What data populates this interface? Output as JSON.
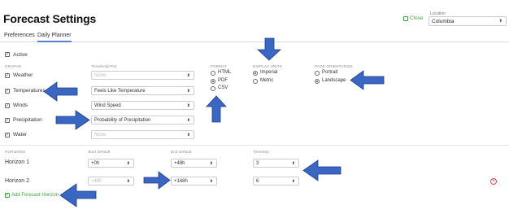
{
  "header": {
    "title": "Forecast Settings",
    "close_label": "Close",
    "location_label": "Location",
    "location_value": "Columbia"
  },
  "tabs": [
    {
      "label": "Preferences",
      "active": false
    },
    {
      "label": "Daily Planner",
      "active": true
    }
  ],
  "active": {
    "label": "Active",
    "checked": true
  },
  "graphs": {
    "header": "GRAPHS",
    "threshold_header": "Threshold Plot",
    "rows": [
      {
        "label": "Weather",
        "checked": true,
        "threshold": "None",
        "threshold_muted": true
      },
      {
        "label": "Temperatures",
        "checked": true,
        "threshold": "Feels Like Temperature",
        "threshold_muted": false
      },
      {
        "label": "Winds",
        "checked": true,
        "threshold": "Wind Speed",
        "threshold_muted": false
      },
      {
        "label": "Precipitation",
        "checked": true,
        "threshold": "Probability of Precipitation",
        "threshold_muted": false
      },
      {
        "label": "Water",
        "checked": true,
        "threshold": "None",
        "threshold_muted": true
      }
    ]
  },
  "format": {
    "header": "FORMAT",
    "options": [
      {
        "label": "HTML",
        "selected": false
      },
      {
        "label": "PDF",
        "selected": true
      },
      {
        "label": "CSV",
        "selected": false
      }
    ]
  },
  "units": {
    "header": "DISPLAY UNITS",
    "options": [
      {
        "label": "Imperial",
        "selected": true
      },
      {
        "label": "Metric",
        "selected": false
      }
    ]
  },
  "orientation": {
    "header": "PAGE ORIENTATION",
    "options": [
      {
        "label": "Portrait",
        "selected": false
      },
      {
        "label": "Landscape",
        "selected": true
      }
    ]
  },
  "horizons": {
    "header": "HORIZONS",
    "start_header": "Start Default",
    "end_header": "End Default",
    "timestep_header": "Timestep",
    "rows": [
      {
        "label": "Horizon 1",
        "start": "+0h",
        "start_muted": false,
        "end": "+48h",
        "timestep": "3",
        "removable": false
      },
      {
        "label": "Horizon 2",
        "start": "+48h",
        "start_muted": true,
        "end": "+168h",
        "timestep": "6",
        "removable": true
      }
    ],
    "add_label": "Add Forecast Horizon"
  },
  "icons": {
    "select_arrow": "up-down-caret-icon",
    "remove": "remove-circle-icon",
    "add": "plus-square-icon",
    "close": "close-square-icon",
    "annotation": "blue-arrow-icon"
  },
  "colors": {
    "accent_green": "#3aa63a",
    "tab_underline": "#5b7fd6",
    "annotation_arrow": "#3a66c4",
    "annotation_outline": "#1f3f85",
    "remove_red": "#dd4444"
  }
}
